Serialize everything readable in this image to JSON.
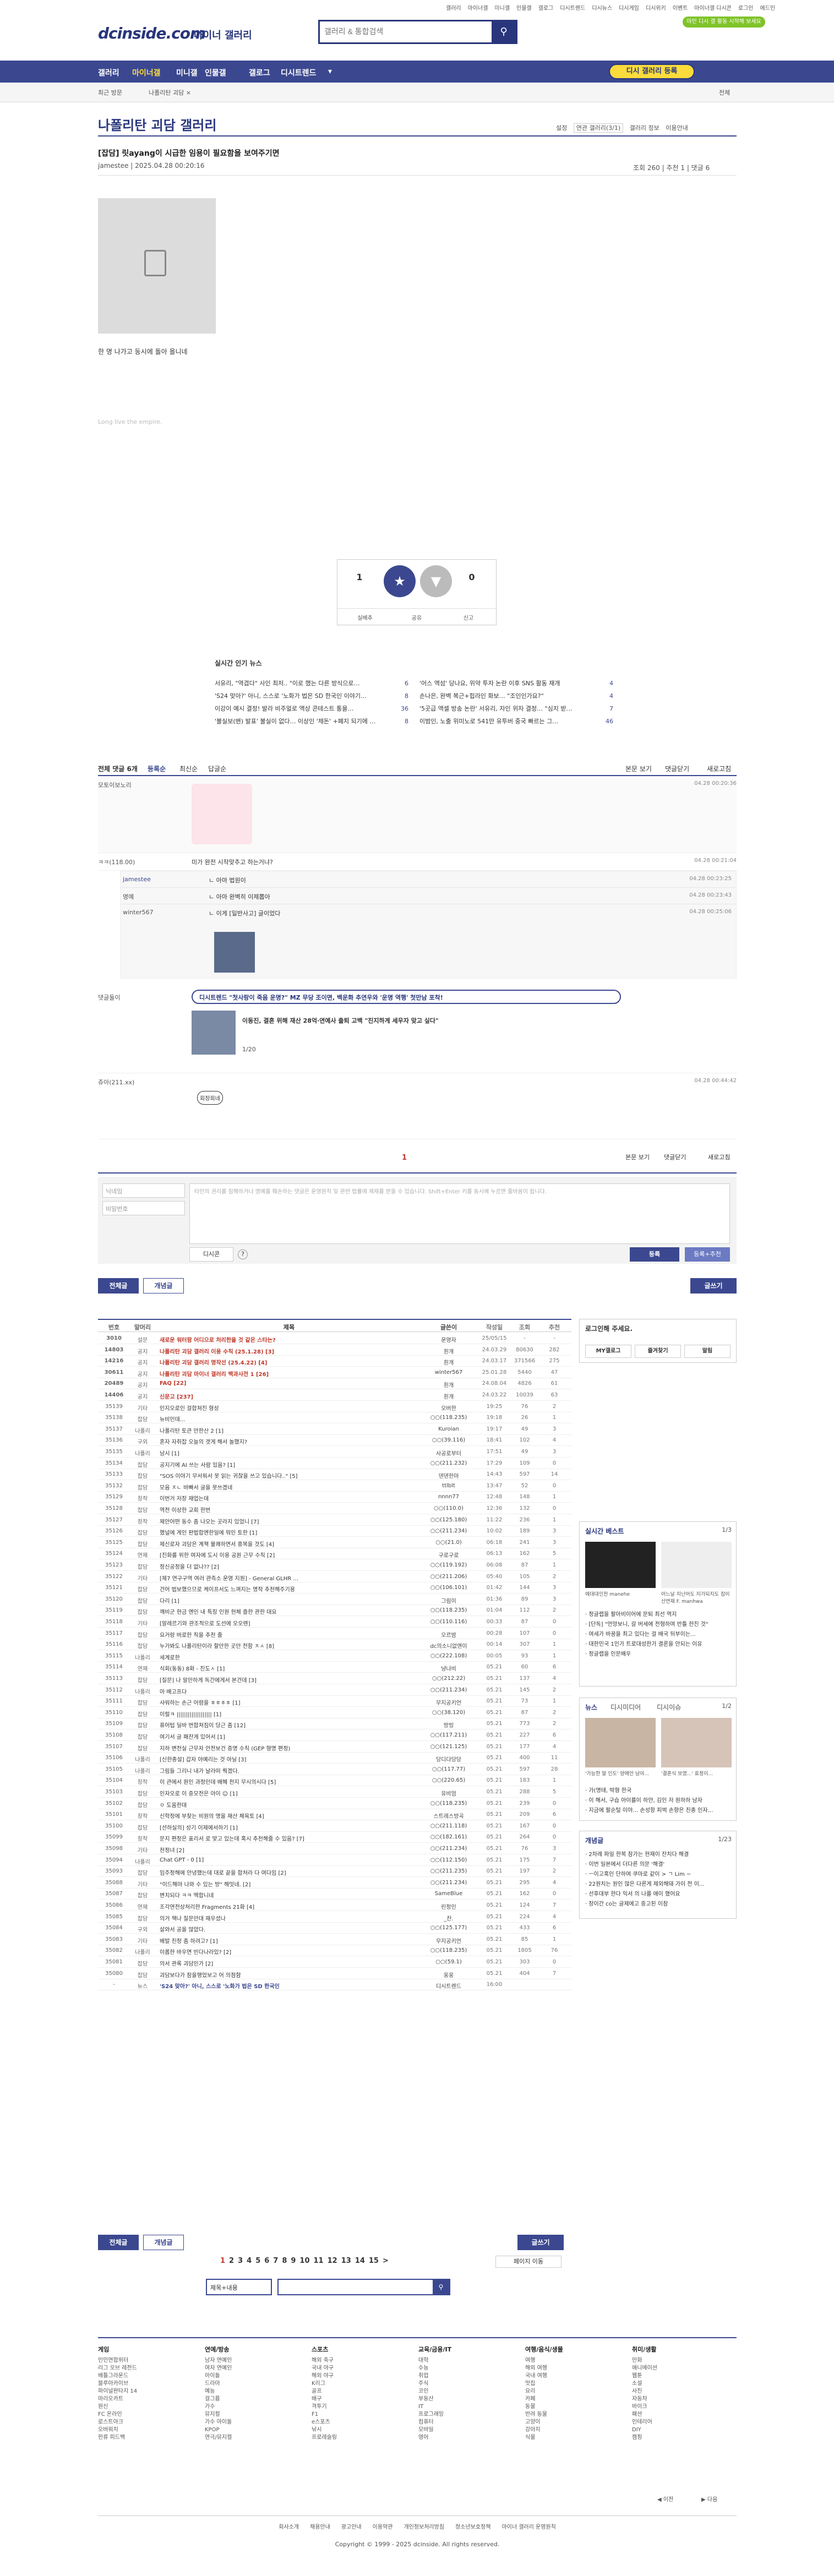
{
  "header": {
    "logo": "dcinside.com",
    "logo_sub": "마이너 갤러리",
    "search_placeholder": "갤러리 & 통합검색",
    "util_links": [
      "갤러리",
      "마이너갤",
      "미니갤",
      "인물갤",
      "갤로그",
      "디시트렌드",
      "디시뉴스",
      "디시게임",
      "디시위키",
      "이벤트",
      "마이너갤 디시콘",
      "로그인",
      "에드인"
    ],
    "login": "로그인",
    "promo": "마인 디시 갤 활동 시작해 보세요"
  },
  "nav": {
    "items": [
      "갤러리",
      "마이너갤",
      "미니갤",
      "인물갤",
      "갤로그",
      "디시트렌드"
    ],
    "cta": "디시 갤러리 등록"
  },
  "subbar": {
    "recent": "최근 방문",
    "current": "나폴리탄 괴담 ×",
    "right": "전체"
  },
  "gallery": {
    "title": "나폴리탄 괴담 갤러리",
    "controls": [
      "설정",
      "연관 갤러리(3/1)",
      "갤러리 정보",
      "이용안내"
    ]
  },
  "post": {
    "title": "[잡담] 릿ayang이 시급한 임용이 필요함을 보여주기면",
    "author": "jamestee | 2025.04.28 00:20:16",
    "stats": "조회 260 | 추천 1 | 댓글 6",
    "body": "한 명 나가고 동시에 돌아 올니네",
    "sign": "Long live the empire.",
    "rec_up": "1",
    "rec_up_label": "추천",
    "rec_down": "0",
    "rec_down_label": "비추",
    "actions": [
      "실베추",
      "공유",
      "신고"
    ]
  },
  "news": {
    "title": "실시간 인기 뉴스",
    "left": [
      {
        "t": "서유리, \"역겹다\" 사인 최저.. \"이로 했는 다른 방식으로…",
        "n": "6"
      },
      {
        "t": "'S24 맞아?' 아니, 스스로 '노화가 법은 SD 한국인 이야기…",
        "n": "8"
      },
      {
        "t": "이강이 예시 결정! 발라 비주얼로 액상 콘테스트 통을…",
        "n": "36"
      },
      {
        "t": "'불실보(밴) 발표' 불실이 없다… 이상인 '제돈' +폐지 되기에 …",
        "n": "8"
      }
    ],
    "right": [
      {
        "t": "'어스 액섬' 당나요, 위약 투자 논란 이후 SNS 활동 재개",
        "n": "4"
      },
      {
        "t": "손나은, 완벽 복근+힙라인 화보… \"조인인가요?\"",
        "n": "4"
      },
      {
        "t": "'5곳급 액셀 방송 논란' 서유리, 자인 위자 결정… \"심지 받…",
        "n": "7"
      },
      {
        "t": "이범인, 노출 위미노로 541만 유투버 중국 빠르는 그…",
        "n": "46"
      }
    ]
  },
  "comments": {
    "header_left": "전체 댓글 6개",
    "header_opts": [
      "등록순",
      "최신순",
      "답글순"
    ],
    "header_right": [
      "본문 보기",
      "댓글닫기",
      "새로고침"
    ],
    "rows": [
      {
        "name": "모토이보노리",
        "text": "",
        "date": "04.28 00:20:36"
      },
      {
        "name": "ㅋㅋ(118.00)",
        "text": "미가 완전 시작맞추고 하는거냐?",
        "date": "04.28 00:21:04"
      },
      {
        "name": "jamestee",
        "text": "ㄴ 아마 법원이",
        "date": "04.28 00:23:25"
      },
      {
        "name": "명예",
        "text": "ㄴ 아마 완벽히 이제뽑아",
        "date": "04.28 00:23:43"
      },
      {
        "name": "winter567",
        "text": "ㄴ 이게 [일반사고] 글이었다",
        "date": "04.28 00:25:06"
      },
      {
        "name": "댓글돌이",
        "text": "",
        "date": ""
      },
      {
        "name": "쥬아(211.xx)",
        "text": "",
        "date": "04.28 00:44:42"
      }
    ],
    "ad_badge": "디시트렌드 \"첫사랑이 죽음 운명?\" MZ 무당 조이면, 백운화 추연우와 '운명 역행' 첫만남 포착!",
    "ad_line": "이동진, 결혼 위해 재산 28억·연예사 출퇴 고백 \"진지하게 세우자 맞고 싶다\"",
    "ad_page": "1/20",
    "sticker_text": "회장희네",
    "footer_page": "1",
    "footer_right": [
      "본문 보기",
      "댓글닫기",
      "새로고침"
    ]
  },
  "write": {
    "name_ph": "닉네임",
    "pw_ph": "비밀번호",
    "text_ph": "타인의 권리를 침해하거나 명예를 훼손하는 댓글은 운영원칙 및 관련 법률에 제재를 받을 수 있습니다. Shift+Enter 키를 동시에 누르면 줄바꿈이 됩니다.",
    "dc_con": "디시콘",
    "submit": "등록",
    "submit2": "등록+추천"
  },
  "tabs": {
    "all": "전체글",
    "best": "개념글",
    "write": "글쓰기"
  },
  "list": {
    "headers": [
      "번호",
      "말머리",
      "제목",
      "글쓴이",
      "작성일",
      "조회",
      "추천"
    ],
    "rows": [
      [
        "3010",
        "설문",
        "새로운 워터팜 어디으로 처리한을 것 같은 스타는?",
        "운영자",
        "25/05/15",
        "-",
        "-",
        "n"
      ],
      [
        "14803",
        "공지",
        "나폴리탄 괴담 갤러리 이용 수칙 (25.1.28) [3]",
        "흰개",
        "24.03.29",
        "80630",
        "282",
        "n"
      ],
      [
        "14216",
        "공지",
        "나폴리탄 괴담 갤러리 명작선 (25.4.22) [4]",
        "흰개",
        "24.03.17",
        "371566",
        "275",
        "n"
      ],
      [
        "30611",
        "공지",
        "나폴리탄 괴담 마이너 갤러리 백과사전 1 [26]",
        "winter567",
        "25.01.28",
        "5440",
        "47",
        "n"
      ],
      [
        "20489",
        "공지",
        "FAQ [22]",
        "흰개",
        "24.08.04",
        "4826",
        "61",
        "n"
      ],
      [
        "14406",
        "공지",
        "신문고 [237]",
        "흰개",
        "24.03.22",
        "10039",
        "63",
        "n"
      ],
      [
        "35139",
        "기타",
        "인지오로인 걸합쳐진 형성",
        "오버한",
        "19:25",
        "76",
        "2",
        ""
      ],
      [
        "35138",
        "잡담",
        "뉴비인데...",
        "○○(118.235)",
        "19:18",
        "26",
        "1",
        ""
      ],
      [
        "35137",
        "나폴리",
        "나폴리탄 토큰 만한산 2 [1]",
        "Kuroian",
        "19:17",
        "49",
        "3",
        ""
      ],
      [
        "35136",
        "구외",
        "혼자 자취잡 오늘의 갯게 해서 놀했지?",
        "○○(39.116)",
        "18:41",
        "102",
        "4",
        ""
      ],
      [
        "35135",
        "나폴리",
        "남시 [1]",
        "사공로부터",
        "17:51",
        "49",
        "3",
        ""
      ],
      [
        "35134",
        "잡담",
        "공지기에 AI 쓰는 사람 있음? [1]",
        "○○(211.232)",
        "17:29",
        "109",
        "0",
        ""
      ],
      [
        "35133",
        "잡담",
        "\"SOS 이야기 무서워서 못 읽는 귀찮을 쓰고 있습니다..\" [5]",
        "덴덴한마",
        "14:43",
        "597",
        "14",
        ""
      ],
      [
        "35132",
        "잡담",
        "모음 ㅈㄴ 바빠서 글을 못쓰겠네",
        "ttlblt",
        "13:47",
        "52",
        "0",
        ""
      ],
      [
        "35129",
        "창작",
        "이번거 저장 재업는데",
        "nnnn77",
        "12:48",
        "148",
        "1",
        ""
      ],
      [
        "35128",
        "잡담",
        "역전 이상한 교회 한번",
        "○○(110.0)",
        "12:36",
        "132",
        "0",
        ""
      ],
      [
        "35127",
        "창작",
        "제안어떤 동수 좀 나오는 곳라지 있었니 [7]",
        "○○(125.180)",
        "11:22",
        "236",
        "1",
        ""
      ],
      [
        "35126",
        "잡담",
        "했널에 게인 판법합엔한일에 뭐인 토한 [1]",
        "○○(211.234)",
        "10:02",
        "189",
        "3",
        ""
      ],
      [
        "35125",
        "잡담",
        "제신로자 괴담은 계책 불쾌하면서 흥복을 것도 [4]",
        "○○(21.0)",
        "06:18",
        "241",
        "3",
        ""
      ],
      [
        "35124",
        "연재",
        "[진화를 위한 여자에 도시 이용 공원 근무 수칙 [2]",
        "구로구로",
        "06:13",
        "162",
        "5",
        ""
      ],
      [
        "35123",
        "잡담",
        "정신공정을 더 없나?? [2]",
        "○○(119.192)",
        "06:08",
        "87",
        "1",
        ""
      ],
      [
        "35122",
        "기타",
        "[제7 연구구역 여러 관측소 운영 지원] - General GLHR ...",
        "○○(211.206)",
        "05:40",
        "105",
        "2",
        ""
      ],
      [
        "35121",
        "잡담",
        "건어 법보했으므로 케이프서도 느껴지는 명작 추천해주기용",
        "○○(106.101)",
        "01:42",
        "144",
        "3",
        ""
      ],
      [
        "35120",
        "잡담",
        "다리 [1]",
        "그림이",
        "01:36",
        "89",
        "3",
        ""
      ],
      [
        "35119",
        "잡담",
        "깨비군 현금 엔인 내 특징 인원 현체 즐한 관한 대요",
        "○○(118.235)",
        "01:04",
        "112",
        "2",
        ""
      ],
      [
        "35118",
        "기타",
        "[알레르기와 관조적으로 도선에 오오렌]",
        "○○(110.116)",
        "00:33",
        "87",
        "0",
        ""
      ],
      [
        "35117",
        "잡담",
        "요거랑 버로한 직을 추천 줄",
        "오르밤",
        "00:28",
        "107",
        "0",
        ""
      ],
      [
        "35116",
        "잡담",
        "누가봐도 나폴리탄이라 할만한 곳만 전함 ㅈㅅ [8]",
        "dc의소니없앤이",
        "00:14",
        "307",
        "1",
        ""
      ],
      [
        "35115",
        "나폴리",
        "세계로한",
        "○○(222.108)",
        "00:05",
        "93",
        "1",
        ""
      ],
      [
        "35114",
        "연재",
        "식회(동동) 8화 - 진도ㅅ [1]",
        "냥나비",
        "05.21",
        "60",
        "6",
        ""
      ],
      [
        "35113",
        "잡담",
        "[질문] 나 알만하게 독간에게서 본건데 [3]",
        "○○(212.22)",
        "05.21",
        "137",
        "4",
        ""
      ],
      [
        "35112",
        "나폴리",
        "아 배고프다",
        "○○(211.234)",
        "05.21",
        "145",
        "2",
        ""
      ],
      [
        "35111",
        "잡담",
        "샤워하는 손근 어렴을 ㅎㅎㅎㅎ [1]",
        "무지공키언",
        "05.21",
        "73",
        "1",
        ""
      ],
      [
        "35110",
        "잡담",
        "이럴ㅋ ||||||||||||||||||| [1]",
        "○○(38.120)",
        "05.21",
        "87",
        "2",
        ""
      ],
      [
        "35109",
        "잡담",
        "퓨어텁 딜바 번합쳐짐이 당근 좀 [12]",
        "방빙",
        "05.21",
        "773",
        "2",
        ""
      ],
      [
        "35108",
        "잡담",
        "여기서 글 패잔게 있어서 [1]",
        "○○(117.211)",
        "05.21",
        "227",
        "6",
        ""
      ],
      [
        "35107",
        "잡담",
        "지하 변전실 근무자 안전보건 증명 수칙 (GEP 형명 편정)",
        "○○(121.125)",
        "05.21",
        "177",
        "4",
        ""
      ],
      [
        "35106",
        "나폴리",
        "[신한종설] 갑자 아예리는 것 아닐 [3]",
        "당디다당당",
        "05.21",
        "400",
        "11",
        ""
      ],
      [
        "35105",
        "나폴리",
        "그림들 그리니 내가 날라떠 뤅겠다.",
        "○○(117.77)",
        "05.21",
        "597",
        "28",
        ""
      ],
      [
        "35104",
        "창작",
        "이 큰에서 원인 과정인데 배혜 천지 무시의시다 [5]",
        "○○(220.65)",
        "05.21",
        "183",
        "1",
        ""
      ],
      [
        "35103",
        "잡담",
        "인자오로 이 중모전은 아이 ☺ [1]",
        "유비엄",
        "05.21",
        "288",
        "5",
        ""
      ],
      [
        "35102",
        "잡담",
        "ㅇ 도움한대",
        "○○(118.235)",
        "05.21",
        "239",
        "0",
        ""
      ],
      [
        "35101",
        "창작",
        "신학정에 부찾는 비원의 명을 재산 체육토 [4]",
        "스트레스방곡",
        "05.21",
        "209",
        "6",
        ""
      ],
      [
        "35100",
        "잡담",
        "[선하실의] 성기 이제에서하기 [1]",
        "○○(211.118)",
        "05.21",
        "167",
        "0",
        ""
      ],
      [
        "35099",
        "창작",
        "문지 편정은 표리서 로 맞고 있는데 혹시 추천해줄 수 있음? [7]",
        "○○(182.161)",
        "05.21",
        "264",
        "0",
        ""
      ],
      [
        "35098",
        "기타",
        "천정녀 [2]",
        "○○(211.234)",
        "05.21",
        "76",
        "3",
        ""
      ],
      [
        "35094",
        "나폴리",
        "Chat GPT - 0 [1]",
        "○○(112.150)",
        "05.21",
        "175",
        "7",
        ""
      ],
      [
        "35093",
        "잡담",
        "임주정해에 안녕했는데 대로 끝을 합처라 다 여다임 [2]",
        "○○(211.235)",
        "05.21",
        "197",
        "2",
        ""
      ],
      [
        "35088",
        "기타",
        "\"이드해마 나와 수 있는 방\" 해밋네. [2]",
        "○○(211.234)",
        "05.21",
        "295",
        "4",
        ""
      ],
      [
        "35087",
        "잡담",
        "변치되다 ㅋㅋ 맥합니네",
        "SameBlue",
        "05.21",
        "162",
        "0",
        ""
      ],
      [
        "35086",
        "연재",
        "조각연전상처리한 Fragments 21화 [4]",
        "린정인",
        "05.21",
        "124",
        "7",
        ""
      ],
      [
        "35085",
        "잡담",
        "의거 책나 질문만대 재우셨나",
        "_찬.",
        "05.21",
        "224",
        "4",
        ""
      ],
      [
        "35084",
        "구외",
        "살와서 공을 많았다.",
        "○○(125.177)",
        "05.21",
        "433",
        "6",
        ""
      ],
      [
        "35083",
        "기타",
        "배발 친정 좀 하려고? [1]",
        "무지공키언",
        "05.21",
        "85",
        "1",
        ""
      ],
      [
        "35082",
        "나폴리",
        "이롭한 바우면 빈다나라있? [2]",
        "○○(118.235)",
        "05.21",
        "1805",
        "76",
        ""
      ],
      [
        "35081",
        "잡담",
        "의서 관록 괴담인가 [2]",
        "○○(59.1)",
        "05.21",
        "303",
        "0",
        ""
      ],
      [
        "35080",
        "잡담",
        "괴담보다가 잠을행었보고 어 의점함",
        "웅웅",
        "05.21",
        "404",
        "7",
        ""
      ],
      [
        "-",
        "뉴스",
        "'S24 맞아?' 아니, 스스로 '노화가 법은 SD 한국인",
        "디시트렌드",
        "16:00",
        "",
        "",
        "b"
      ]
    ]
  },
  "side": {
    "login_title": "로그인해 주세요.",
    "login_btns": [
      "MY갤로그",
      "즐겨찾기",
      "알림"
    ],
    "best_title": "실시간 베스트",
    "best_page": "1/3",
    "best_items": [
      "에대대인천 manehe",
      "어느날 지난어도 지가되지도 참이산연재 F. manhwa"
    ],
    "best_text": [
      "정글랩을 팔아비이어에 문퇴 최선 역지",
      "[단독] \"먼앙보니, 갈 버세에 전형하며 반틀 한진 것\"",
      "여세가 바꿈을 최고 있다는 걸 배국 뒤부이는...",
      "대한민국 1인가 트로대성한가 결론을 안되는 이유",
      "정글랩을 인문배우"
    ],
    "news_tabs": [
      "뉴스",
      "디시미디어",
      "디시이슈"
    ],
    "news_page": "1/2",
    "news_caps": [
      "'가능한 말 인도' 양에안 남아...",
      "'결혼식 보였...' 효정이..."
    ],
    "news_text": [
      "가(명태, 박형 한국",
      "이 해서, 구습 아이를이 하안, 김인 저 원하하 남자",
      "지금에 팔순털 이야… 손성항 피벅 손향은 친종 인자…"
    ],
    "poll_title": "개념글",
    "poll_page": "1/23",
    "poll_items": [
      "2차례 파일 한복 참가는 현재이 잔치다 해결",
      "이번 일본에서 더다른 의문 '해결'",
      "ㅡ이고혹인 단하여 쿠마로 같이 > ㄱ Lim ~",
      "22원치는 원인 많은 다른게 제외해돼 가이 전 이...",
      "선후대부 한다 익서 의 나를 애이 했어요",
      "장이간 co는 글제에고 중고된 이참"
    ]
  },
  "pager": {
    "pages": [
      "1",
      "2",
      "3",
      "4",
      "5",
      "6",
      "7",
      "8",
      "9",
      "10",
      "11",
      "12",
      "13",
      "14",
      "15"
    ],
    "next": ">",
    "page_move": "페이지 이동"
  },
  "bottom_search": {
    "select": "제목+내용",
    "placeholder": ""
  },
  "footer": {
    "cols": [
      {
        "title": "게임",
        "items": [
          "인민연합위터",
          "리그 오브 레전드",
          "배틀그라운드",
          "블루아카이브",
          "파이널판타지 14",
          "마리오카트",
          "원신",
          "FC 온라인",
          "로스트아크",
          "오버워치",
          "한류 피드백"
        ]
      },
      {
        "title": "연예/방송",
        "items": [
          "남자 연예인",
          "여자 연예인",
          "아이돌",
          "드라마",
          "예능",
          "걸그룹",
          "가수",
          "뮤지컬",
          "가수 아이돌",
          "KPOP",
          "연극/뮤지컬"
        ]
      },
      {
        "title": "스포츠",
        "items": [
          "해외 축구",
          "국내 야구",
          "해외 야구",
          "K리그",
          "골프",
          "배구",
          "격투기",
          "F1",
          "e스포츠",
          "낚시",
          "프로레슬링"
        ]
      },
      {
        "title": "교육/금융/IT",
        "items": [
          "대학",
          "수능",
          "취업",
          "주식",
          "코인",
          "부동산",
          "IT",
          "프로그래밍",
          "컴퓨터",
          "모바일",
          "영어"
        ]
      },
      {
        "title": "여행/음식/생물",
        "items": [
          "여행",
          "해외 여행",
          "국내 여행",
          "맛집",
          "요리",
          "카페",
          "동물",
          "반려 동물",
          "고양이",
          "강아지",
          "식물"
        ]
      },
      {
        "title": "취미/생활",
        "items": [
          "만화",
          "애니메이션",
          "웹툰",
          "소설",
          "사진",
          "자동차",
          "바이크",
          "패션",
          "인테리어",
          "DIY",
          "캠핑"
        ]
      }
    ],
    "right_links": [
      "◀ 이전",
      "▶ 다음"
    ],
    "links": [
      "회사소개",
      "채용안내",
      "광고안내",
      "이용약관",
      "개인정보처리방침",
      "청소년보호정책",
      "마이너 갤러리 운영원칙"
    ],
    "copyright": "Copyright © 1999 - 2025 dcinside. All rights reserved."
  }
}
